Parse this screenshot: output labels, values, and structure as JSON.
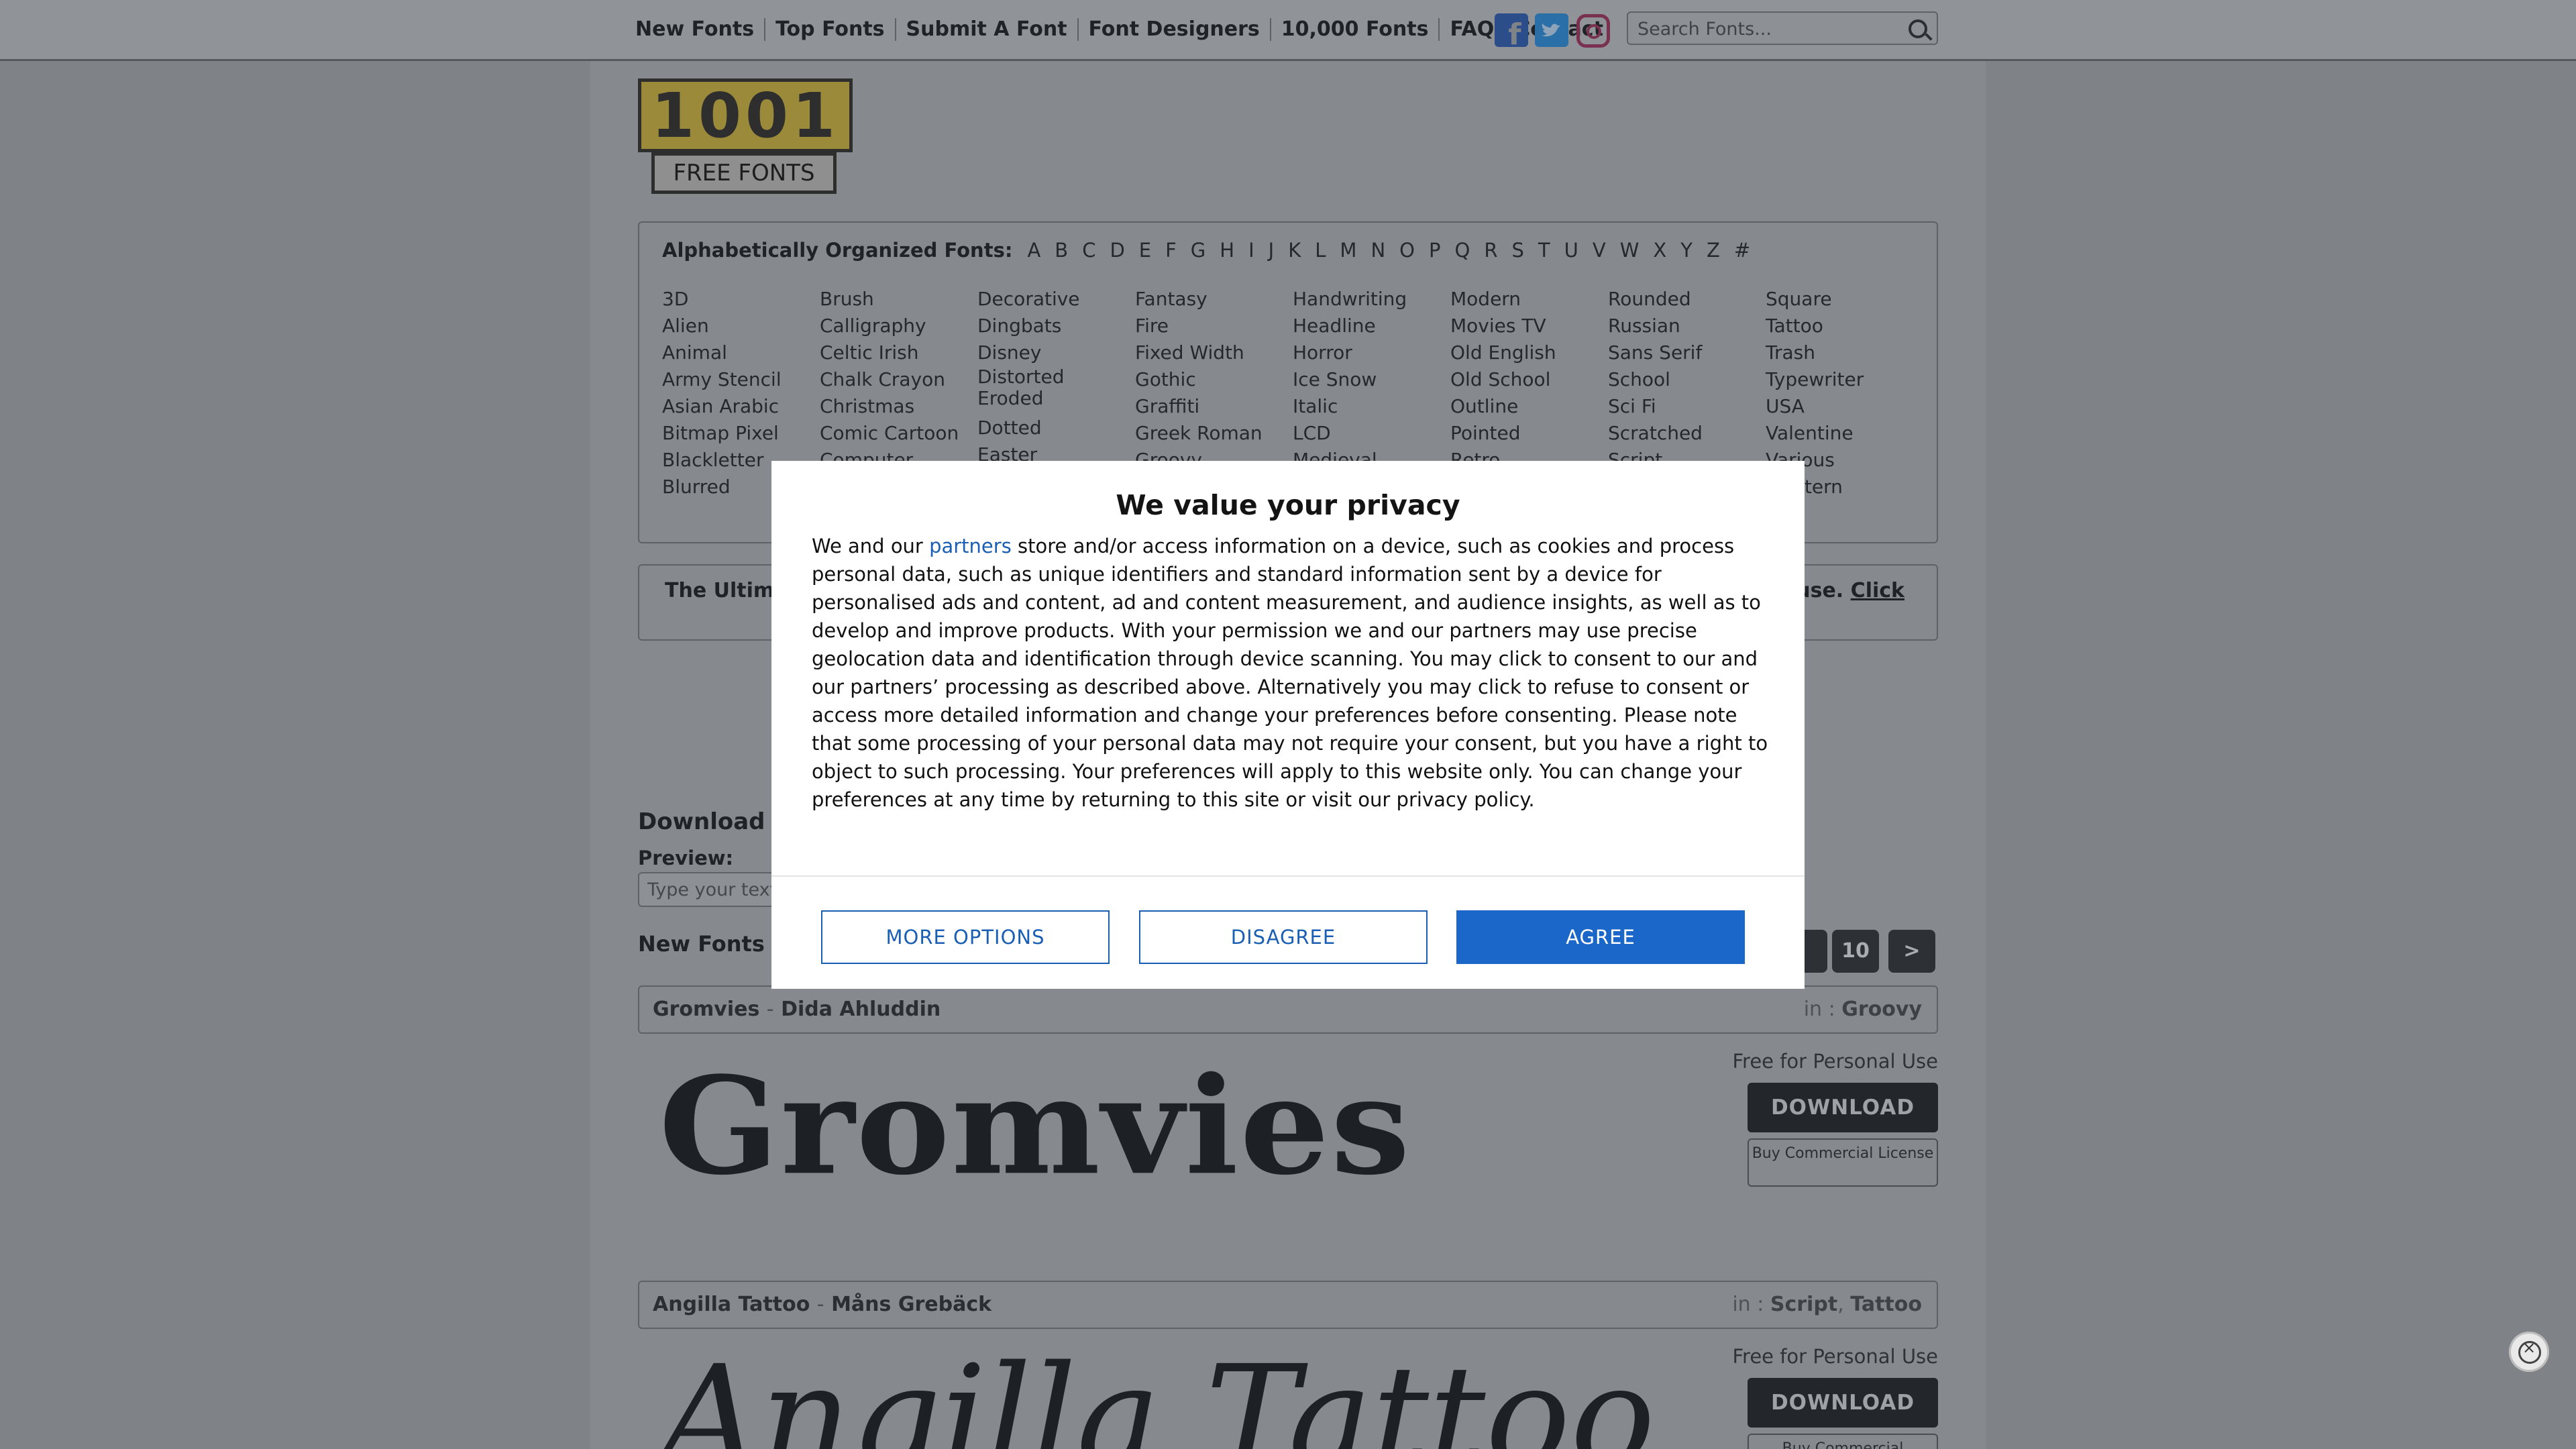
{
  "nav": {
    "items": [
      "New Fonts",
      "Top Fonts",
      "Submit A Font",
      "Font Designers",
      "10,000 Fonts",
      "FAQ",
      "Contact"
    ],
    "social": [
      "facebook-icon",
      "twitter-icon",
      "instagram-icon"
    ]
  },
  "search": {
    "placeholder": "Search Fonts..."
  },
  "logo": {
    "digits": "1001",
    "sub": "FREE FONTS"
  },
  "alphabet": {
    "label": "Alphabetically Organized Fonts:",
    "letters": [
      "A",
      "B",
      "C",
      "D",
      "E",
      "F",
      "G",
      "H",
      "I",
      "J",
      "K",
      "L",
      "M",
      "N",
      "O",
      "P",
      "Q",
      "R",
      "S",
      "T",
      "U",
      "V",
      "W",
      "X",
      "Y",
      "Z",
      "#"
    ]
  },
  "categories": {
    "col1": [
      "3D",
      "Alien",
      "Animal",
      "Army Stencil",
      "Asian Arabic",
      "Bitmap Pixel",
      "Blackletter",
      "Blurred"
    ],
    "col2": [
      "Brush",
      "Calligraphy",
      "Celtic Irish",
      "Chalk Crayon",
      "Christmas",
      "Comic Cartoon",
      "Computer"
    ],
    "col3": [
      "Decorative",
      "Dingbats",
      "Disney",
      "Distorted Eroded",
      "Dotted",
      "Easter"
    ],
    "col4": [
      "Fantasy",
      "Fire",
      "Fixed Width",
      "Gothic",
      "Graffiti",
      "Greek Roman",
      "Groovy"
    ],
    "col5": [
      "Handwriting",
      "Headline",
      "Horror",
      "Ice Snow",
      "Italic",
      "LCD",
      "Medieval"
    ],
    "col6": [
      "Modern",
      "Movies TV",
      "Old English",
      "Old School",
      "Outline",
      "Pointed",
      "Retro"
    ],
    "col7": [
      "Rounded",
      "Russian",
      "Sans Serif",
      "School",
      "Sci Fi",
      "Scratched",
      "Script"
    ],
    "col8": [
      "Square",
      "Tattoo",
      "Trash",
      "Typewriter",
      "USA",
      "Valentine",
      "Various",
      "Western"
    ]
  },
  "banner": {
    "left": "The Ultima",
    "right": "use.",
    "click": "Click"
  },
  "download_heading": "Download F",
  "preview": {
    "label": "Preview:",
    "placeholder": "Type your text"
  },
  "new_fonts_heading": "New Fonts -",
  "pagination": {
    "ten": "10",
    "next": ">"
  },
  "fonts": [
    {
      "name": "Gromvies",
      "author": "Dida Ahluddin",
      "in_label": "in :",
      "categories": [
        "Groovy"
      ],
      "license": "Free for Personal Use",
      "download": "DOWNLOAD",
      "buy": "Buy Commercial License",
      "preview": "Gromvies"
    },
    {
      "name": "Angilla Tattoo",
      "author": "Måns Grebäck",
      "in_label": "in :",
      "categories": [
        "Script",
        "Tattoo"
      ],
      "license": "Free for Personal Use",
      "download": "DOWNLOAD",
      "buy": "Buy Commercial",
      "preview": "Angilla Tattoo"
    }
  ],
  "consent": {
    "title": "We value your privacy",
    "text_before_link": "We and our ",
    "link": "partners",
    "text_after_link": " store and/or access information on a device, such as cookies and process personal data, such as unique identifiers and standard information sent by a device for personalised ads and content, ad and content measurement, and audience insights, as well as to develop and improve products. With your permission we and our partners may use precise geolocation data and identification through device scanning. You may click to consent to our and our partners’ processing as described above. Alternatively you may click to refuse to consent or access more detailed information and change your preferences before consenting. Please note that some processing of your personal data may not require your consent, but you have a right to object to such processing. Your preferences will apply to this website only. You can change your preferences at any time by returning to this site or visit our privacy policy.",
    "buttons": {
      "more": "MORE OPTIONS",
      "disagree": "DISAGREE",
      "agree": "AGREE"
    }
  },
  "colors": {
    "accent": "#1a66c9",
    "overlay": "#7f8287",
    "dark_button": "#23272c"
  }
}
